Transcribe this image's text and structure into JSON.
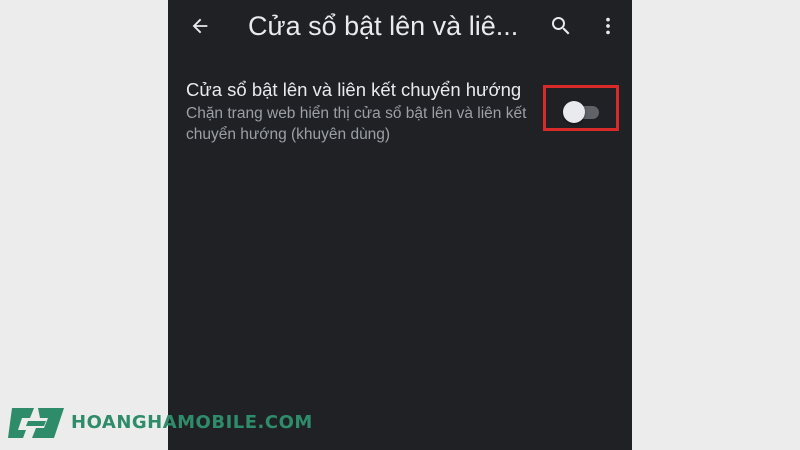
{
  "header": {
    "title": "Cửa sổ bật lên và liê...",
    "back_icon": "arrow-back-icon",
    "search_icon": "search-icon",
    "more_icon": "more-vert-icon"
  },
  "setting": {
    "title": "Cửa sổ bật lên và liên kết chuyển hướng",
    "description": "Chặn trang web hiển thị cửa sổ bật lên và liên kết chuyển hướng (khuyên dùng)",
    "toggle_on": false
  },
  "watermark": {
    "text": "HOANGHAMOBILE.COM"
  },
  "colors": {
    "background": "#202124",
    "text_primary": "#e8eaed",
    "text_secondary": "#9aa0a6",
    "highlight": "#d92a2a",
    "brand": "#2e8c6a"
  }
}
